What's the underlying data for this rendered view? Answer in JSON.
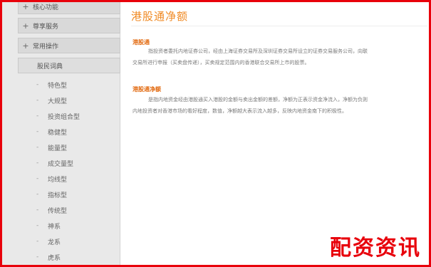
{
  "sidebar": {
    "groups": [
      {
        "label": "核心功能"
      },
      {
        "label": "尊享服务"
      },
      {
        "label": "常用操作"
      },
      {
        "label": "股民词典"
      }
    ],
    "items": [
      {
        "label": "特色型"
      },
      {
        "label": "大规型"
      },
      {
        "label": "投资组合型"
      },
      {
        "label": "稳健型"
      },
      {
        "label": "能量型"
      },
      {
        "label": "成交量型"
      },
      {
        "label": "均线型"
      },
      {
        "label": "指标型"
      },
      {
        "label": "传统型"
      },
      {
        "label": "神系"
      },
      {
        "label": "龙系"
      },
      {
        "label": "虎系"
      }
    ]
  },
  "main": {
    "title": "港股通净额",
    "sections": [
      {
        "heading": "港股通",
        "lines": [
          "指投资者委托内地证券公司，经由上海证券交易所及深圳证券交易所设立的证券交易服务公司，向联",
          "交易所进行申报（买卖盘传递），买卖规定范围内的香港联合交易所上市的股票。"
        ]
      },
      {
        "heading": "港股通净额",
        "lines": [
          "是指内地资金经由港股通买入港股的金额与卖出金额的差额，净额为正表示资金净流入，净额为负则",
          "内地投资者对香港市场的看好程度，数值，净额越大表示流入越多，反映内地资金南下的积极性。"
        ]
      }
    ]
  },
  "watermark": "配资资讯",
  "colors": {
    "border": "#e8000b",
    "title": "#f08a24",
    "heading": "#e26a10",
    "sidebar_bg": "#e9e9e9"
  }
}
